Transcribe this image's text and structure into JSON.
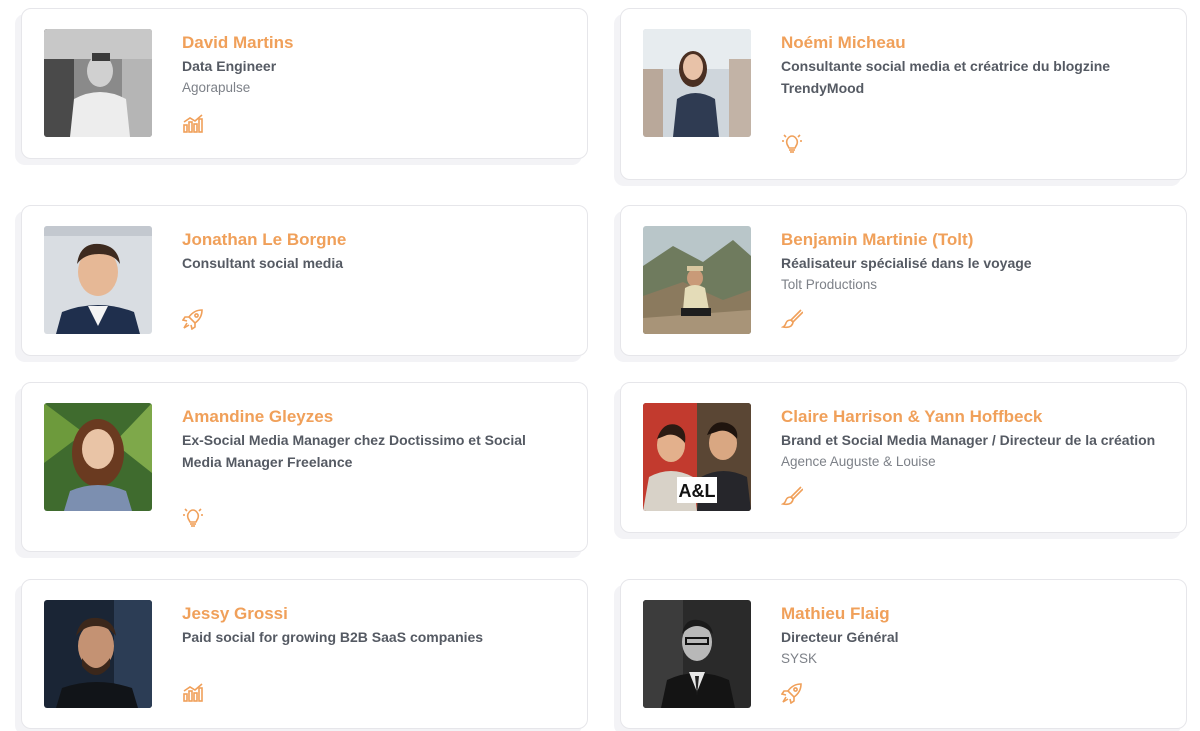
{
  "accent_color": "#f0a05a",
  "people": [
    {
      "name": "David Martins",
      "role": "Data Engineer",
      "company": "Agorapulse",
      "icon": "chart-bars-icon"
    },
    {
      "name": "Noémi Micheau",
      "role": "Consultante social media et créatrice du blogzine TrendyMood",
      "company": "",
      "icon": "lightbulb-icon"
    },
    {
      "name": "Jonathan Le Borgne",
      "role": "Consultant social media",
      "company": "",
      "icon": "rocket-icon"
    },
    {
      "name": "Benjamin Martinie (Tolt)",
      "role": "Réalisateur spécialisé dans le voyage",
      "company": "Tolt Productions",
      "icon": "paintbrush-icon"
    },
    {
      "name": "Amandine Gleyzes",
      "role": "Ex-Social Media Manager chez Doctissimo et Social Media Manager Freelance",
      "company": "",
      "icon": "lightbulb-icon"
    },
    {
      "name": "Claire Harrison & Yann Hoffbeck",
      "role": "Brand et Social Media Manager / Directeur de la création",
      "company": "Agence Auguste & Louise",
      "icon": "paintbrush-icon",
      "photo_badge": "A&L"
    },
    {
      "name": "Jessy Grossi",
      "role": "Paid social for growing B2B SaaS companies",
      "company": "",
      "icon": "chart-bars-icon"
    },
    {
      "name": "Mathieu Flaig",
      "role": "Directeur Général",
      "company": "SYSK",
      "icon": "rocket-icon"
    }
  ]
}
